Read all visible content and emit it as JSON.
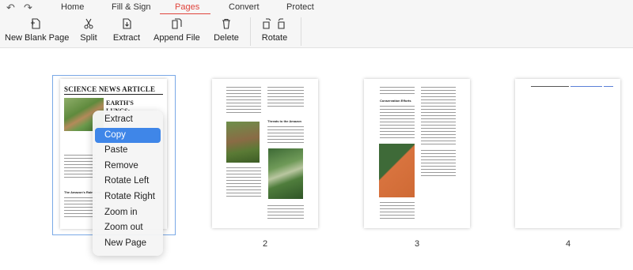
{
  "topbar": {
    "undo_icon": "undo-icon",
    "redo_icon": "redo-icon",
    "tabs": [
      {
        "label": "Home"
      },
      {
        "label": "Fill & Sign"
      },
      {
        "label": "Pages",
        "active": true
      },
      {
        "label": "Convert"
      },
      {
        "label": "Protect"
      }
    ],
    "accent_color": "#e0443c"
  },
  "toolbar": {
    "new_blank_page": "New Blank Page",
    "split": "Split",
    "extract": "Extract",
    "append_file": "Append File",
    "delete": "Delete",
    "rotate": "Rotate"
  },
  "pages": {
    "page1": {
      "title": "SCIENCE NEWS ARTICLE",
      "subtitle_1": "EARTH'S",
      "subtitle_2": "LUNGS:",
      "section": "The Amazon's Rainforest"
    },
    "page2": {
      "heading": "Threats to the Amazon",
      "number": "2"
    },
    "page3": {
      "heading": "Conservation Efforts",
      "number": "3"
    },
    "page4": {
      "number": "4"
    }
  },
  "context_menu": {
    "items": [
      "Extract",
      "Copy",
      "Paste",
      "Remove",
      "Rotate Left",
      "Rotate Right",
      "Zoom in",
      "Zoom out",
      "New Page"
    ],
    "highlighted": "Copy",
    "highlight_color": "#3f86e8"
  }
}
